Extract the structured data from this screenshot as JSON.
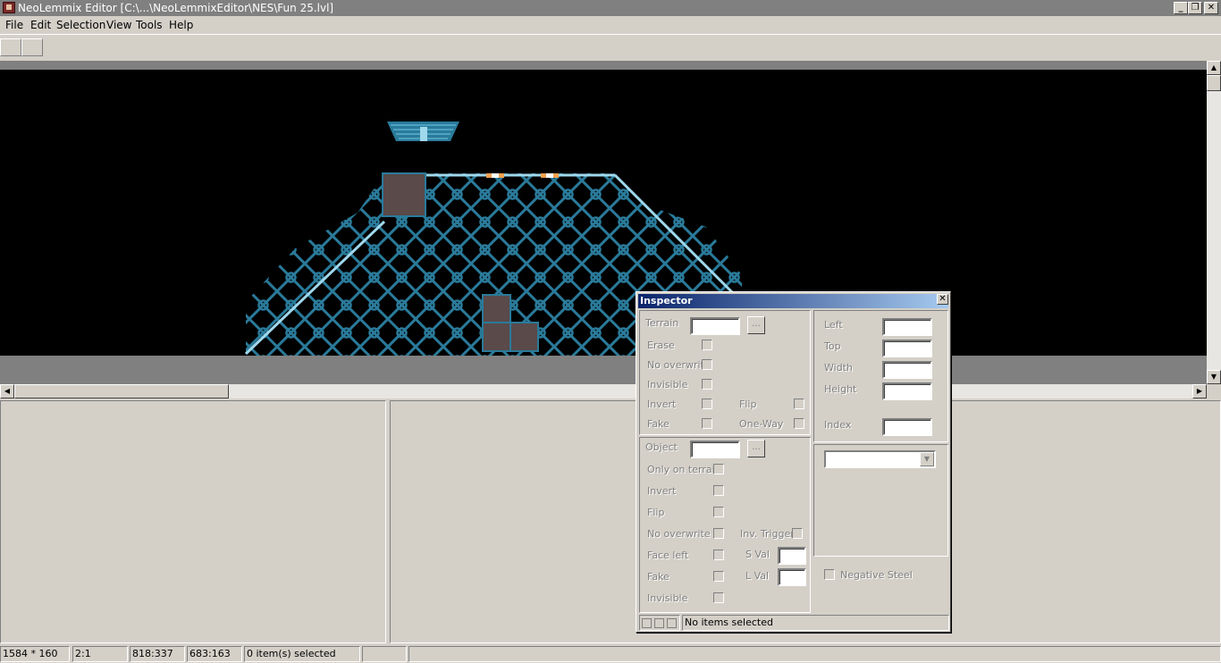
{
  "window": {
    "title": "NeoLemmix Editor [C:\\...\\NeoLemmixEditor\\NES\\Fun 25.lvl]",
    "minimize_glyph": "_",
    "restore_glyph": "❐",
    "close_glyph": "✕"
  },
  "menu": [
    "File",
    "Edit",
    "Selection",
    "View",
    "Tools",
    "Help"
  ],
  "scroll_glyphs": {
    "up": "▲",
    "down": "▼",
    "left": "◀",
    "right": "▶",
    "combo": "▼"
  },
  "inspector": {
    "title": "Inspector",
    "close_glyph": "✕",
    "browse_label": "...",
    "terrain": {
      "label": "Terrain",
      "erase": "Erase",
      "no_overwrite": "No overwrite",
      "invisible": "Invisible",
      "invert": "Invert",
      "flip": "Flip",
      "fake": "Fake",
      "one_way": "One-Way"
    },
    "position": {
      "left": "Left",
      "top": "Top",
      "width": "Width",
      "height": "Height",
      "index": "Index"
    },
    "object": {
      "label": "Object",
      "only_on_terrain": "Only on terrain",
      "invert": "Invert",
      "flip": "Flip",
      "no_overwrite": "No overwrite",
      "inv_trigger": "Inv. Trigger",
      "face_left": "Face left",
      "s_val": "S Val",
      "fake": "Fake",
      "l_val": "L Val",
      "invisible": "Invisible"
    },
    "negative_steel": "Negative Steel",
    "status_text": "No items selected"
  },
  "statusbar": {
    "level_size": "1584 * 160",
    "zoom": "2:1",
    "cursor_pos": "818:337",
    "level_pos": "683:163",
    "selection": "0 item(s) selected",
    "empty1": "",
    "empty2": ""
  },
  "colors": {
    "terrain_pattern": "#2a7a9a",
    "terrain_highlight": "#9fd8ec",
    "block_fill": "#5a4a4a",
    "title_gradient_start": "#0a246a",
    "title_gradient_end": "#a6caf0"
  }
}
